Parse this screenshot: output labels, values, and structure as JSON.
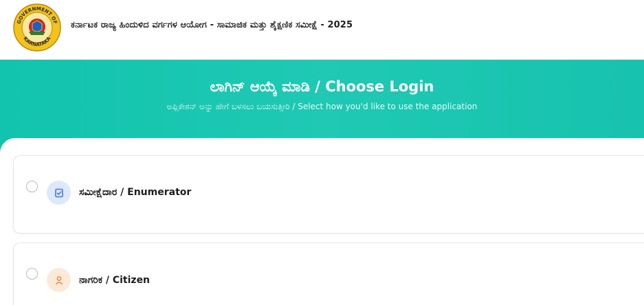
{
  "header": {
    "emblem_icon": "karnataka-emblem-icon",
    "emblem_text_top": "GOVERNMENT OF",
    "emblem_text_bottom": "KARNATAKA",
    "title": "ಕರ್ನಾಟಕ ರಾಜ್ಯ ಹಿಂದುಳಿದ ವರ್ಗಗಳ ಆಯೋಗ - ಸಾಮಾಜಿಕ ಮತ್ತು ಶೈಕ್ಷಣಿಕ ಸಮೀಕ್ಷೆ - 2025"
  },
  "banner": {
    "title": "ಲಾಗಿನ್ ಆಯ್ಕೆ ಮಾಡಿ / Choose Login",
    "subtitle": "ಅಪ್ಲಿಕೇಶನ್ ಅನ್ನು ಹೇಗೆ ಬಳಸಲು ಬಯಸುತ್ತೀರಿ / Select how you'd like to use the application"
  },
  "options": [
    {
      "label": "ಸಮೀಕ್ಷೆದಾರ / Enumerator",
      "icon": "checklist-icon",
      "color": "#dde8fb",
      "selected": false
    },
    {
      "label": "ನಾಗರಿಕ / Citizen",
      "icon": "person-icon",
      "color": "#fde9d8",
      "selected": false
    }
  ],
  "colors": {
    "banner": "#1fc9b4",
    "enumerator_icon": "#4a74d8",
    "citizen_icon": "#ec8b4a"
  }
}
